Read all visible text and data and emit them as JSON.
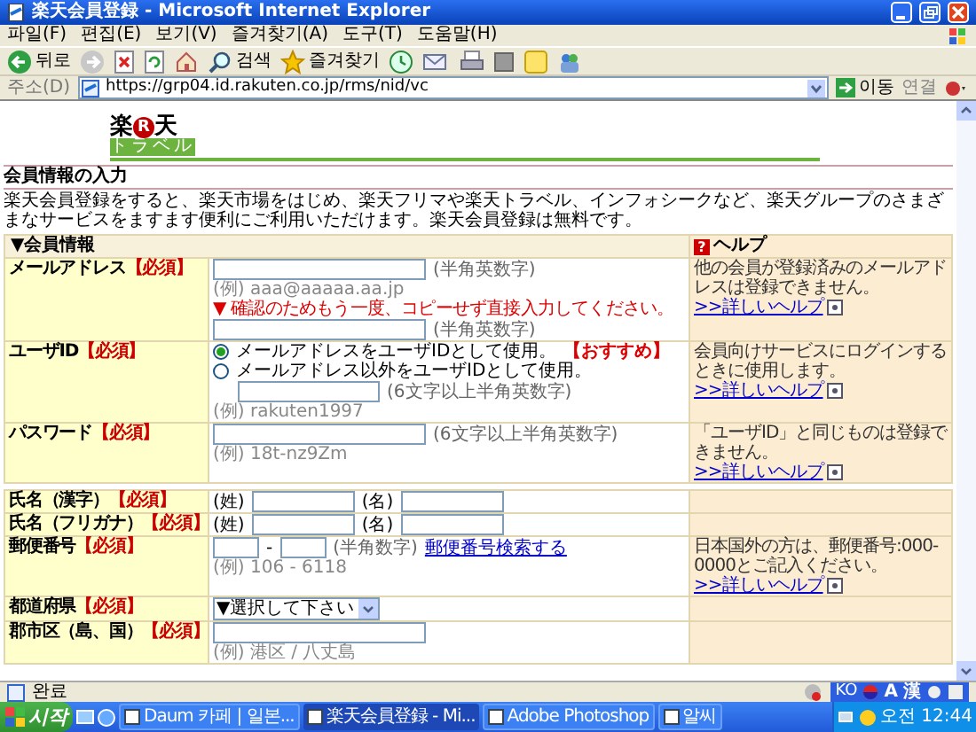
{
  "window": {
    "title": "楽天会員登録 - Microsoft Internet Explorer"
  },
  "menu": [
    "파일(F)",
    "편집(E)",
    "보기(V)",
    "즐겨찾기(A)",
    "도구(T)",
    "도움말(H)"
  ],
  "toolbar": {
    "back": "뒤로",
    "search": "검색",
    "favorites": "즐겨찾기"
  },
  "address_bar": {
    "label": "주소(D)",
    "url": "https://grp04.id.rakuten.co.jp/rms/nid/vc",
    "go": "이동",
    "links": "연결"
  },
  "logo": {
    "left": "楽",
    "mark": "R",
    "right": "天",
    "sub": "トラベル"
  },
  "section_title": "会員情報の入力",
  "intro": "楽天会員登録をすると、楽天市場をはじめ、楽天フリマや楽天トラベル、インフォシークなど、楽天グループのさまざまなサービスをますます便利にご利用いただけます。楽天会員登録は無料です。",
  "form": {
    "header": "▼会員情報",
    "help_icon": "?",
    "help_header": "ヘルプ",
    "groups": [
      [
        {
          "label": "メールアドレス",
          "required": "【必須】",
          "lines": [
            [
              {
                "kind": "field"
              },
              {
                "kind": "hint",
                "text": "(半角英数字)"
              }
            ],
            [
              {
                "kind": "example",
                "text": "(例) aaa@aaaaa.aa.jp"
              }
            ],
            [
              {
                "kind": "warning",
                "text": "▼ 確認のためもう一度、コピーせず直接入力してください。"
              }
            ],
            [
              {
                "kind": "field"
              },
              {
                "kind": "hint",
                "text": "(半角英数字)"
              }
            ]
          ],
          "help": {
            "text": "他の会員が登録済みのメールアドレスは登録できません。",
            "link": ">>詳しいヘルプ"
          }
        },
        {
          "label": "ユーザID",
          "required": "【必須】",
          "lines": [
            [
              {
                "kind": "radio",
                "text": "メールアドレスをユーザIDとして使用。",
                "selected": true
              },
              {
                "kind": "badge",
                "text": "【おすすめ】"
              }
            ],
            [
              {
                "kind": "radio",
                "text": "メールアドレス以外をユーザIDとして使用。",
                "selected": false
              }
            ],
            [
              {
                "kind": "indent_field"
              },
              {
                "kind": "hint",
                "text": "(6文字以上半角英数字)"
              }
            ],
            [
              {
                "kind": "example",
                "text": "(例) rakuten1997"
              }
            ]
          ],
          "help": {
            "text": "会員向けサービスにログインするときに使用します。",
            "link": ">>詳しいヘルプ"
          }
        },
        {
          "label": "パスワード",
          "required": "【必須】",
          "lines": [
            [
              {
                "kind": "field"
              },
              {
                "kind": "hint",
                "text": "(6文字以上半角英数字)"
              }
            ],
            [
              {
                "kind": "example",
                "text": "(例) 18t-nz9Zm"
              }
            ]
          ],
          "help": {
            "text": "「ユーザID」と同じものは登録できません。",
            "link": ">>詳しいヘルプ"
          }
        }
      ],
      [
        {
          "label": "氏名（漢字）",
          "required": "【必須】",
          "lines": [
            [
              {
                "kind": "text",
                "text": "(姓)"
              },
              {
                "kind": "name_field"
              },
              {
                "kind": "text",
                "text": "(名)"
              },
              {
                "kind": "name_field"
              }
            ]
          ]
        },
        {
          "label": "氏名（フリガナ）",
          "required": "【必須】",
          "lines": [
            [
              {
                "kind": "text",
                "text": "(姓)"
              },
              {
                "kind": "name_field"
              },
              {
                "kind": "text",
                "text": "(名)"
              },
              {
                "kind": "name_field"
              }
            ]
          ]
        },
        {
          "label": "郵便番号",
          "required": "【必須】",
          "lines": [
            [
              {
                "kind": "zip_field"
              },
              {
                "kind": "text",
                "text": "-"
              },
              {
                "kind": "zip_field"
              },
              {
                "kind": "hint",
                "text": "(半角数字)"
              },
              {
                "kind": "link",
                "text": "郵便番号検索する"
              }
            ],
            [
              {
                "kind": "example",
                "text": "(例) 106 - 6118"
              }
            ]
          ],
          "help": {
            "text": "日本国外の方は、郵便番号:000-0000とご記入ください。",
            "link": ">>詳しいヘルプ"
          }
        },
        {
          "label": "都道府県",
          "required": "【必須】",
          "lines": [
            [
              {
                "kind": "select",
                "text": "▼選択して下さい"
              }
            ]
          ]
        },
        {
          "label": "郡市区（島、国）",
          "required": "【必須】",
          "lines": [
            [
              {
                "kind": "field"
              }
            ],
            [
              {
                "kind": "example",
                "text": "(例) 港区 / 八丈島"
              }
            ]
          ]
        }
      ]
    ]
  },
  "status_bar": {
    "text": "완료"
  },
  "language_bar": {
    "lang": "KO",
    "mode": "A",
    "hanja": "漢"
  },
  "taskbar": {
    "start": "시작",
    "tasks": [
      {
        "label": "Daum 카페 | 일본...",
        "selected": false
      },
      {
        "label": "楽天会員登録 - Mi...",
        "selected": true
      },
      {
        "label": "Adobe Photoshop",
        "selected": false
      },
      {
        "label": "알씨",
        "selected": false
      }
    ],
    "clock": "오전 12:44"
  }
}
